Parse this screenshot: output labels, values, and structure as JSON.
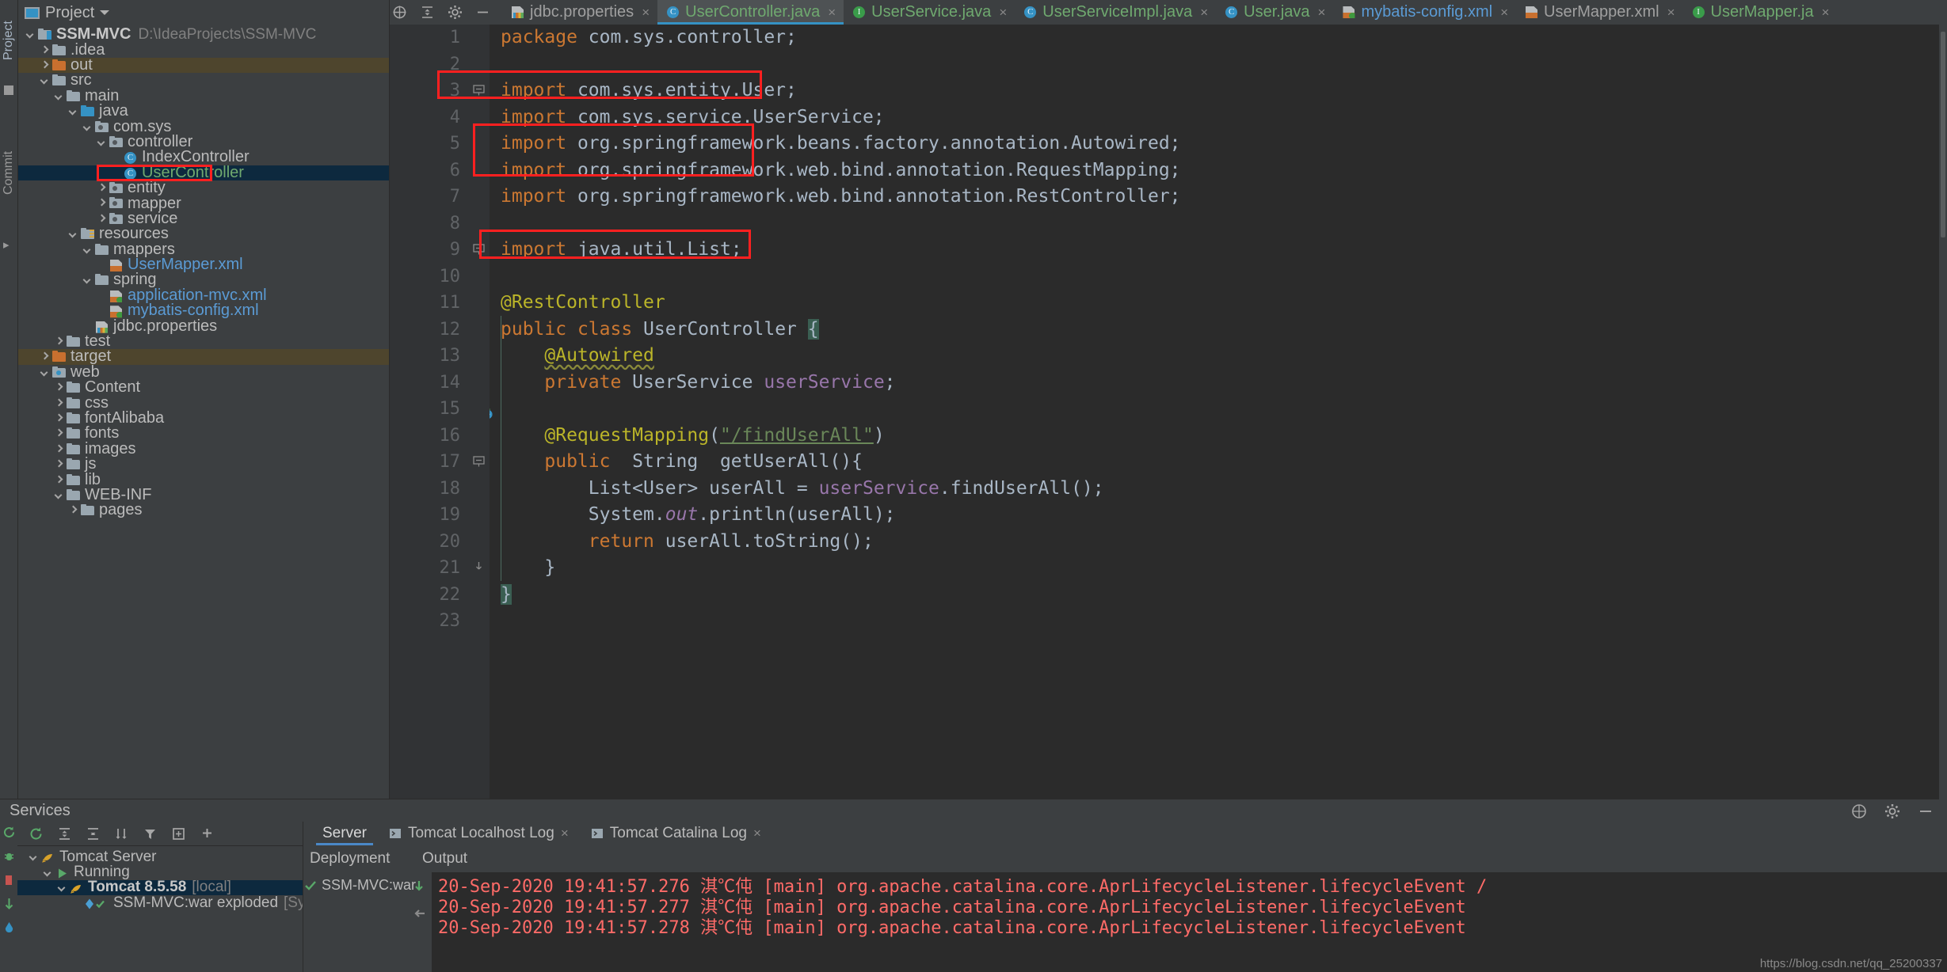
{
  "window": {
    "left_strip": {
      "project_label": "Project",
      "commit_label": "Commit"
    }
  },
  "project_panel": {
    "header_title": "Project",
    "header_icon": "project-panel-icon",
    "tree": [
      {
        "label": "SSM-MVC",
        "detail": "D:\\IdeaProjects\\SSM-MVC",
        "indent": 0,
        "arrow": "down",
        "icon": "module-folder",
        "style": "bold"
      },
      {
        "label": ".idea",
        "indent": 1,
        "arrow": "right",
        "icon": "folder-gray"
      },
      {
        "label": "out",
        "indent": 1,
        "arrow": "right",
        "icon": "folder-orange",
        "row": "amber"
      },
      {
        "label": "src",
        "indent": 1,
        "arrow": "down",
        "icon": "folder-gray"
      },
      {
        "label": "main",
        "indent": 2,
        "arrow": "down",
        "icon": "folder-gray"
      },
      {
        "label": "java",
        "indent": 3,
        "arrow": "down",
        "icon": "folder-blue"
      },
      {
        "label": "com.sys",
        "indent": 4,
        "arrow": "down",
        "icon": "package"
      },
      {
        "label": "controller",
        "indent": 5,
        "arrow": "down",
        "icon": "package"
      },
      {
        "label": "IndexController",
        "indent": 6,
        "arrow": "none",
        "icon": "java-class"
      },
      {
        "label": "UserController",
        "indent": 6,
        "arrow": "none",
        "icon": "java-class",
        "row": "selected",
        "style": "green",
        "annotated": true
      },
      {
        "label": "entity",
        "indent": 5,
        "arrow": "right",
        "icon": "package"
      },
      {
        "label": "mapper",
        "indent": 5,
        "arrow": "right",
        "icon": "package"
      },
      {
        "label": "service",
        "indent": 5,
        "arrow": "right",
        "icon": "package"
      },
      {
        "label": "resources",
        "indent": 3,
        "arrow": "down",
        "icon": "folder-resources"
      },
      {
        "label": "mappers",
        "indent": 4,
        "arrow": "down",
        "icon": "folder-gray"
      },
      {
        "label": "UserMapper.xml",
        "indent": 5,
        "arrow": "none",
        "icon": "xml-file",
        "style": "blue"
      },
      {
        "label": "spring",
        "indent": 4,
        "arrow": "down",
        "icon": "folder-gray"
      },
      {
        "label": "application-mvc.xml",
        "indent": 5,
        "arrow": "none",
        "icon": "spring-xml-file",
        "style": "blue"
      },
      {
        "label": "mybatis-config.xml",
        "indent": 5,
        "arrow": "none",
        "icon": "spring-xml-file",
        "style": "blue"
      },
      {
        "label": "jdbc.properties",
        "indent": 4,
        "arrow": "none",
        "icon": "properties-file"
      },
      {
        "label": "test",
        "indent": 2,
        "arrow": "right",
        "icon": "folder-gray"
      },
      {
        "label": "target",
        "indent": 1,
        "arrow": "right",
        "icon": "folder-orange",
        "row": "amber"
      },
      {
        "label": "web",
        "indent": 1,
        "arrow": "down",
        "icon": "folder-web"
      },
      {
        "label": "Content",
        "indent": 2,
        "arrow": "right",
        "icon": "folder-gray"
      },
      {
        "label": "css",
        "indent": 2,
        "arrow": "right",
        "icon": "folder-gray"
      },
      {
        "label": "fontAlibaba",
        "indent": 2,
        "arrow": "right",
        "icon": "folder-gray"
      },
      {
        "label": "fonts",
        "indent": 2,
        "arrow": "right",
        "icon": "folder-gray"
      },
      {
        "label": "images",
        "indent": 2,
        "arrow": "right",
        "icon": "folder-gray"
      },
      {
        "label": "js",
        "indent": 2,
        "arrow": "right",
        "icon": "folder-gray"
      },
      {
        "label": "lib",
        "indent": 2,
        "arrow": "right",
        "icon": "folder-gray"
      },
      {
        "label": "WEB-INF",
        "indent": 2,
        "arrow": "down",
        "icon": "folder-gray"
      },
      {
        "label": "pages",
        "indent": 3,
        "arrow": "right",
        "icon": "folder-gray"
      }
    ]
  },
  "editor": {
    "tabs": [
      {
        "label": "jdbc.properties",
        "icon": "properties-file",
        "active": false,
        "style": "plain"
      },
      {
        "label": "UserController.java",
        "icon": "java-class",
        "active": true,
        "style": "green"
      },
      {
        "label": "UserService.java",
        "icon": "java-interface",
        "active": false,
        "style": "green"
      },
      {
        "label": "UserServiceImpl.java",
        "icon": "java-class",
        "active": false,
        "style": "green"
      },
      {
        "label": "User.java",
        "icon": "java-class",
        "active": false,
        "style": "green"
      },
      {
        "label": "mybatis-config.xml",
        "icon": "spring-xml-file",
        "active": false,
        "style": "blue"
      },
      {
        "label": "UserMapper.xml",
        "icon": "xml-file",
        "active": false,
        "style": "plain"
      },
      {
        "label": "UserMapper.ja",
        "icon": "java-interface",
        "active": false,
        "style": "green"
      }
    ],
    "close_glyph": "×",
    "toolbar_icons": [
      "locate-icon",
      "collapse-all-icon",
      "settings-gear-icon",
      "hide-panel-icon"
    ],
    "line_numbers": [
      "1",
      "2",
      "3",
      "4",
      "5",
      "6",
      "7",
      "8",
      "9",
      "10",
      "11",
      "12",
      "13",
      "14",
      "15",
      "16",
      "17",
      "18",
      "19",
      "20",
      "21",
      "22",
      "23"
    ],
    "code_lines": [
      {
        "n": 1,
        "segments": [
          {
            "t": "package ",
            "c": "kw"
          },
          {
            "t": "com.sys.controller;",
            "c": "plain"
          }
        ]
      },
      {
        "n": 2,
        "segments": []
      },
      {
        "n": 3,
        "segments": [
          {
            "t": "import ",
            "c": "kw"
          },
          {
            "t": "com.sys.entity.User;",
            "c": "plain"
          }
        ],
        "fold": "collapse-start"
      },
      {
        "n": 4,
        "segments": [
          {
            "t": "import ",
            "c": "kw"
          },
          {
            "t": "com.sys.service.UserService;",
            "c": "plain"
          }
        ]
      },
      {
        "n": 5,
        "segments": [
          {
            "t": "import ",
            "c": "kw"
          },
          {
            "t": "org.springframework.beans.factory.annotation.Autowired;",
            "c": "plain"
          }
        ]
      },
      {
        "n": 6,
        "segments": [
          {
            "t": "import ",
            "c": "kw"
          },
          {
            "t": "org.springframework.web.bind.annotation.RequestMapping;",
            "c": "plain"
          }
        ]
      },
      {
        "n": 7,
        "segments": [
          {
            "t": "import ",
            "c": "kw"
          },
          {
            "t": "org.springframework.web.bind.annotation.RestController;",
            "c": "plain"
          }
        ]
      },
      {
        "n": 8,
        "segments": []
      },
      {
        "n": 9,
        "segments": [
          {
            "t": "import ",
            "c": "kw"
          },
          {
            "t": "java.util.List;",
            "c": "plain"
          }
        ],
        "fold": "collapse-start"
      },
      {
        "n": 10,
        "segments": []
      },
      {
        "n": 11,
        "segments": [
          {
            "t": "@RestController",
            "c": "ann"
          }
        ],
        "annotated": true
      },
      {
        "n": 12,
        "segments": [
          {
            "t": "public ",
            "c": "kw"
          },
          {
            "t": "class ",
            "c": "kw"
          },
          {
            "t": "UserController ",
            "c": "plain"
          },
          {
            "t": "{",
            "c": "cursor"
          }
        ],
        "gutter_marker": "class-run-marker"
      },
      {
        "n": 13,
        "segments": [
          {
            "t": "    ",
            "c": "plain"
          },
          {
            "t": "@Autowired",
            "c": "ann-squiggly"
          }
        ],
        "annotated": true
      },
      {
        "n": 14,
        "segments": [
          {
            "t": "    ",
            "c": "plain"
          },
          {
            "t": "private ",
            "c": "kw"
          },
          {
            "t": "UserService ",
            "c": "plain"
          },
          {
            "t": "userService",
            "c": "fld"
          },
          {
            "t": ";",
            "c": "plain"
          }
        ],
        "gutter_marker": "bean-marker",
        "annotated": true
      },
      {
        "n": 15,
        "segments": []
      },
      {
        "n": 16,
        "segments": [
          {
            "t": "    ",
            "c": "plain"
          },
          {
            "t": "@RequestMapping",
            "c": "ann"
          },
          {
            "t": "(",
            "c": "plain"
          },
          {
            "t": "\"/findUserAll\"",
            "c": "str-underline"
          },
          {
            "t": ")",
            "c": "plain"
          }
        ],
        "annotated": true
      },
      {
        "n": 17,
        "segments": [
          {
            "t": "    ",
            "c": "plain"
          },
          {
            "t": "public  ",
            "c": "kw"
          },
          {
            "t": "String  ",
            "c": "plain"
          },
          {
            "t": "getUserAll",
            "c": "method"
          },
          {
            "t": "(){",
            "c": "plain"
          }
        ],
        "gutter_marker": "method-run-marker",
        "fold": "collapse-start"
      },
      {
        "n": 18,
        "segments": [
          {
            "t": "        ",
            "c": "plain"
          },
          {
            "t": "List<User> userAll = ",
            "c": "plain"
          },
          {
            "t": "userService",
            "c": "fld"
          },
          {
            "t": ".findUserAll();",
            "c": "plain"
          }
        ]
      },
      {
        "n": 19,
        "segments": [
          {
            "t": "        ",
            "c": "plain"
          },
          {
            "t": "System.",
            "c": "plain"
          },
          {
            "t": "out",
            "c": "stat"
          },
          {
            "t": ".println(userAll);",
            "c": "plain"
          }
        ]
      },
      {
        "n": 20,
        "segments": [
          {
            "t": "        ",
            "c": "plain"
          },
          {
            "t": "return ",
            "c": "kw"
          },
          {
            "t": "userAll.toString();",
            "c": "plain"
          }
        ]
      },
      {
        "n": 21,
        "segments": [
          {
            "t": "    }",
            "c": "plain"
          }
        ],
        "fold": "collapse-end"
      },
      {
        "n": 22,
        "segments": [
          {
            "t": "}",
            "c": "cursor"
          }
        ]
      },
      {
        "n": 23,
        "segments": []
      }
    ]
  },
  "services_panel": {
    "title": "Services",
    "header_icons": [
      "help-icon",
      "settings-gear-icon",
      "hide-panel-icon"
    ],
    "toolbar_icons": [
      "rerun-icon",
      "expand-all-icon",
      "collapse-all-icon",
      "sort-icon",
      "filter-icon",
      "group-icon",
      "add-icon"
    ],
    "side_icons": [
      "rerun-icon",
      "debug-icon",
      "stop-icon",
      "deploy-icon",
      "droplet-icon"
    ],
    "tree": [
      {
        "label": "Tomcat Server",
        "indent": 0,
        "arrow": "down",
        "icon": "tomcat-icon"
      },
      {
        "label": "Running",
        "indent": 1,
        "arrow": "down",
        "icon": "run-green-icon"
      },
      {
        "label": "Tomcat 8.5.58",
        "suffix": "[local]",
        "indent": 2,
        "arrow": "down",
        "icon": "tomcat-icon",
        "row": "selected",
        "style": "bold"
      },
      {
        "label": "SSM-MVC:war exploded",
        "suffix": "[Synchronized]",
        "indent": 3,
        "arrow": "none",
        "icon": "artifact-check-icon"
      }
    ],
    "log_tabs": [
      {
        "label": "Server",
        "active": true,
        "icon": null
      },
      {
        "label": "Tomcat Localhost Log",
        "active": false,
        "icon": "console-icon",
        "closable": true
      },
      {
        "label": "Tomcat Catalina Log",
        "active": false,
        "icon": "console-icon",
        "closable": true
      }
    ],
    "deployment_header": "Deployment",
    "output_header": "Output",
    "deployment_items": [
      {
        "label": "SSM-MVC:war ",
        "icon": "check-icon"
      }
    ],
    "console_lines": [
      "20-Sep-2020 19:41:57.276 淇℃伅 [main] org.apache.catalina.core.AprLifecycleListener.lifecycleEvent /",
      "20-Sep-2020 19:41:57.277 淇℃伅 [main] org.apache.catalina.core.AprLifecycleListener.lifecycleEvent",
      "20-Sep-2020 19:41:57.278 淇℃伅 [main] org.apache.catalina.core.AprLifecycleListener.lifecycleEvent"
    ]
  },
  "watermark": "https://blog.csdn.net/qq_25200337"
}
